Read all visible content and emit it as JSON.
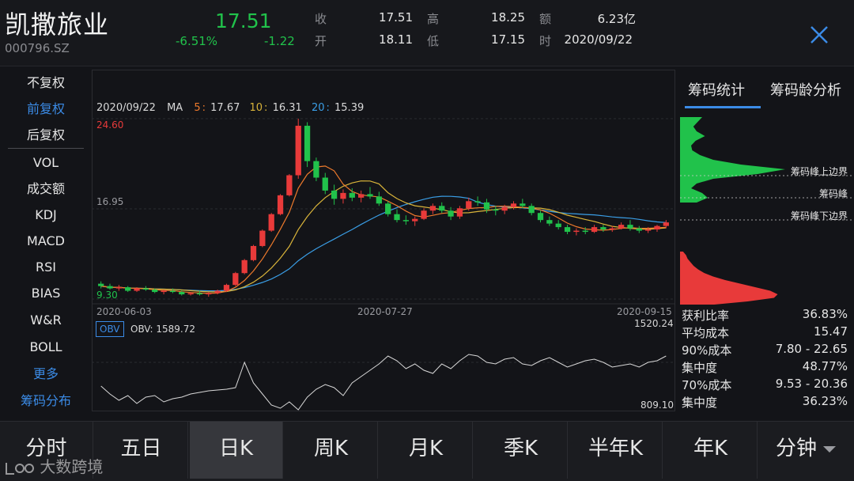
{
  "header": {
    "name": "凯撒旅业",
    "code": "000796.SZ",
    "price": "17.51",
    "pct_change": "-6.51%",
    "change": "-1.22",
    "close_label": "收",
    "close": "17.51",
    "open_label": "开",
    "open": "18.11",
    "high_label": "高",
    "high": "18.25",
    "low_label": "低",
    "low": "17.15",
    "amount_label": "额",
    "amount": "6.23亿",
    "time_label": "时",
    "time": "2020/09/22"
  },
  "left_menu": {
    "items": [
      "不复权",
      "前复权",
      "后复权",
      "VOL",
      "成交额",
      "KDJ",
      "MACD",
      "RSI",
      "BIAS",
      "W&R",
      "BOLL",
      "更多",
      "筹码分布"
    ]
  },
  "chart": {
    "ma": {
      "date": "2020/09/22",
      "label": "MA",
      "ma5_key": "5",
      "ma5": "17.67",
      "ma10_key": "10",
      "ma10": "16.31",
      "ma20_key": "20",
      "ma20": "15.39"
    },
    "price_max_label": "24.60",
    "price_mid_label": "16.95",
    "price_min_label": "9.30",
    "dates": [
      "2020-06-03",
      "2020-07-27",
      "2020-09-15"
    ],
    "obv_tag": "OBV",
    "obv_value": "OBV: 1589.72",
    "obv_max": "1520.24",
    "obv_min": "809.10",
    "colors": {
      "up": "#e83a3a",
      "down": "#21c24b",
      "ma5": "#ee7a2c",
      "ma10": "#d9b43a",
      "ma20": "#3a9ee6"
    }
  },
  "chart_data": {
    "type": "candlestick",
    "price_axis": {
      "min": 9.3,
      "mid": 16.95,
      "max": 24.6
    },
    "x_labels": [
      "2020-06-03",
      "2020-07-27",
      "2020-09-15"
    ],
    "candles_ohlc": [
      [
        10.6,
        10.8,
        10.2,
        10.4
      ],
      [
        10.4,
        10.6,
        10.1,
        10.2
      ],
      [
        10.2,
        10.5,
        10.0,
        10.3
      ],
      [
        10.3,
        10.4,
        9.9,
        10.0
      ],
      [
        10.0,
        10.3,
        9.9,
        10.2
      ],
      [
        10.2,
        10.4,
        10.0,
        10.1
      ],
      [
        10.1,
        10.2,
        9.8,
        9.9
      ],
      [
        9.9,
        10.1,
        9.7,
        10.0
      ],
      [
        10.0,
        10.2,
        9.8,
        9.9
      ],
      [
        9.9,
        10.0,
        9.6,
        9.7
      ],
      [
        9.7,
        9.9,
        9.6,
        9.8
      ],
      [
        9.8,
        10.0,
        9.6,
        9.7
      ],
      [
        9.7,
        9.9,
        9.5,
        9.8
      ],
      [
        9.8,
        10.1,
        9.7,
        10.0
      ],
      [
        10.0,
        10.6,
        9.9,
        10.5
      ],
      [
        10.5,
        11.6,
        10.4,
        11.5
      ],
      [
        11.5,
        12.7,
        11.4,
        12.6
      ],
      [
        12.6,
        13.9,
        12.5,
        13.8
      ],
      [
        13.8,
        15.2,
        13.7,
        15.1
      ],
      [
        15.1,
        16.6,
        15.0,
        16.5
      ],
      [
        16.5,
        18.2,
        16.4,
        18.1
      ],
      [
        18.1,
        19.9,
        18.0,
        19.8
      ],
      [
        19.8,
        24.6,
        19.5,
        24.0
      ],
      [
        24.0,
        24.3,
        20.5,
        21.0
      ],
      [
        21.0,
        21.3,
        19.3,
        19.6
      ],
      [
        19.6,
        20.0,
        18.2,
        18.5
      ],
      [
        18.5,
        19.0,
        17.3,
        17.8
      ],
      [
        17.8,
        18.6,
        17.4,
        18.3
      ],
      [
        18.3,
        18.7,
        17.6,
        17.9
      ],
      [
        17.9,
        18.5,
        17.5,
        18.2
      ],
      [
        18.2,
        18.8,
        17.8,
        18.0
      ],
      [
        18.0,
        18.4,
        17.2,
        17.4
      ],
      [
        17.4,
        17.6,
        16.3,
        16.5
      ],
      [
        16.5,
        16.9,
        15.8,
        16.0
      ],
      [
        16.0,
        16.4,
        15.6,
        15.9
      ],
      [
        15.9,
        16.3,
        15.5,
        16.1
      ],
      [
        16.1,
        17.0,
        16.0,
        16.8
      ],
      [
        16.8,
        17.4,
        16.5,
        17.2
      ],
      [
        17.2,
        17.5,
        16.6,
        16.8
      ],
      [
        16.8,
        17.1,
        16.0,
        16.3
      ],
      [
        16.3,
        17.2,
        16.1,
        17.0
      ],
      [
        17.0,
        17.9,
        16.8,
        17.6
      ],
      [
        17.6,
        18.0,
        17.2,
        17.5
      ],
      [
        17.5,
        17.8,
        16.6,
        16.9
      ],
      [
        16.9,
        17.2,
        16.4,
        16.8
      ],
      [
        16.8,
        17.3,
        16.5,
        17.1
      ],
      [
        17.1,
        17.6,
        16.9,
        17.4
      ],
      [
        17.4,
        17.8,
        17.0,
        17.2
      ],
      [
        17.2,
        17.4,
        16.4,
        16.6
      ],
      [
        16.6,
        16.8,
        15.8,
        16.0
      ],
      [
        16.0,
        16.3,
        15.5,
        15.7
      ],
      [
        15.7,
        16.0,
        15.2,
        15.4
      ],
      [
        15.4,
        15.6,
        14.8,
        15.0
      ],
      [
        15.0,
        15.3,
        14.7,
        15.1
      ],
      [
        15.1,
        15.4,
        14.8,
        15.0
      ],
      [
        15.0,
        15.6,
        14.9,
        15.4
      ],
      [
        15.4,
        15.6,
        15.0,
        15.2
      ],
      [
        15.2,
        15.5,
        15.0,
        15.3
      ],
      [
        15.3,
        15.8,
        15.2,
        15.6
      ],
      [
        15.6,
        16.0,
        15.1,
        15.3
      ],
      [
        15.3,
        15.5,
        14.9,
        15.1
      ],
      [
        15.1,
        15.4,
        14.9,
        15.2
      ],
      [
        15.2,
        15.6,
        15.0,
        15.5
      ],
      [
        15.5,
        16.0,
        15.3,
        15.8
      ]
    ],
    "ma_latest": {
      "MA5": 17.67,
      "MA10": 16.31,
      "MA20": 15.39
    },
    "obv_range": {
      "min": 809.1,
      "max": 1520.24
    },
    "obv_latest": 1589.72
  },
  "right_panel": {
    "tabs": [
      "筹码统计",
      "筹码龄分析"
    ],
    "dist_labels": {
      "upper": "筹码峰上边界",
      "peak": "筹码峰",
      "lower": "筹码峰下边界"
    },
    "stats": [
      {
        "k": "获利比率",
        "v": "36.83%"
      },
      {
        "k": "平均成本",
        "v": "15.47"
      },
      {
        "k": "90%成本",
        "v": "7.80 - 22.65"
      },
      {
        "k": "集中度",
        "v": "48.77%"
      },
      {
        "k": "70%成本",
        "v": "9.53 - 20.36"
      },
      {
        "k": "集中度",
        "v": "36.23%"
      }
    ]
  },
  "bottom_tabs": [
    "分时",
    "五日",
    "日K",
    "周K",
    "月K",
    "季K",
    "半年K",
    "年K",
    "分钟"
  ],
  "watermark": "大数跨境",
  "icons": {
    "close": "close-icon",
    "more": "chevron-down-icon",
    "logo": "watermark-logo-icon"
  }
}
